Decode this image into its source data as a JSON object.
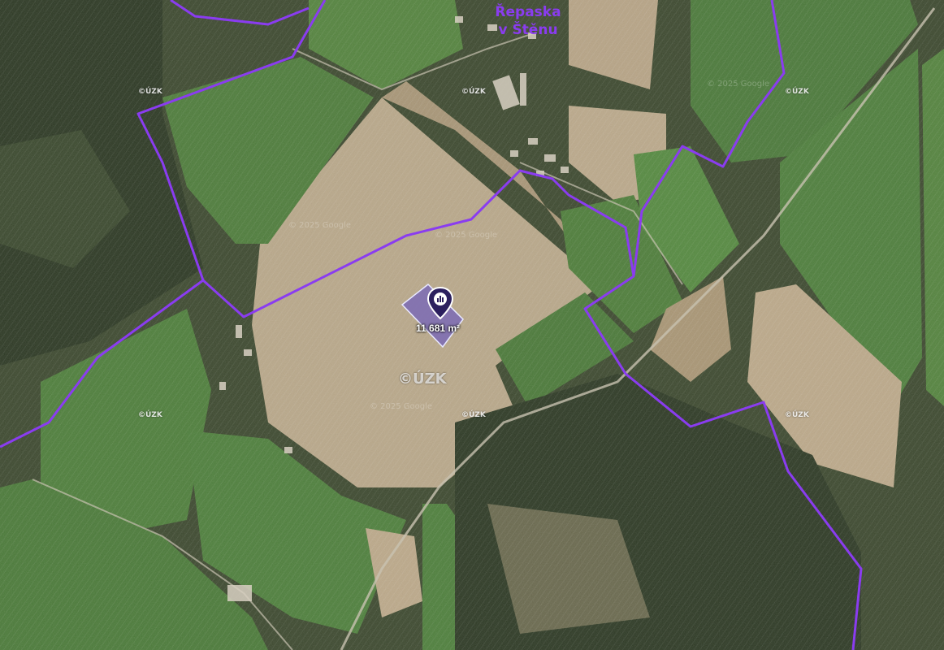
{
  "village": {
    "line1": "Řepaska",
    "line2": "v Štěnu"
  },
  "parcel": {
    "area": "11 681 m²",
    "marker_icon": "map-pin-icon"
  },
  "watermarks": {
    "cuzk": "©ÚZK",
    "google": "© 2025 Google"
  },
  "colors": {
    "boundary": "#8a3cf0",
    "parcel_fill": "#7b6bb5",
    "parcel_stroke": "#e8e8ff",
    "marker": "#2b1f5e"
  }
}
